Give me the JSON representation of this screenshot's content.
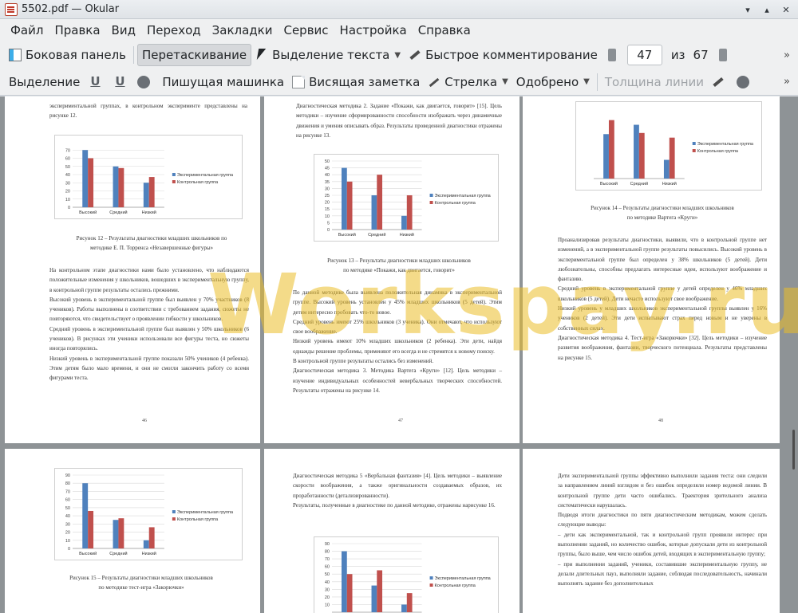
{
  "window": {
    "title": "5502.pdf — Okular",
    "buttons": [
      "▾",
      "▴",
      "✕"
    ]
  },
  "menu": [
    "Файл",
    "Правка",
    "Вид",
    "Переход",
    "Закладки",
    "Сервис",
    "Настройка",
    "Справка"
  ],
  "toolbar": {
    "sidebar": "Боковая панель",
    "browse": "Перетаскивание",
    "text_select": "Выделение текста",
    "quick_annot": "Быстрое комментирование",
    "page_current": "47",
    "page_of": "из",
    "page_total": "67",
    "more": "»"
  },
  "annot_toolbar": {
    "select": "Выделение",
    "typewriter": "Пишущая машинка",
    "pinned_note": "Висящая заметка",
    "arrow": "Стрелка",
    "approved": "Одобрено",
    "line_width": "Толщина линии",
    "more": "»"
  },
  "watermark": "Workspay.ru",
  "legend": {
    "exp": "Экспериментальная группа",
    "ctrl": "Контрольная группа"
  },
  "categories": [
    "Высокий",
    "Средний",
    "Низкий"
  ],
  "colors": {
    "exp": "#4f81bd",
    "ctrl": "#c0504d"
  },
  "pages": {
    "p46": {
      "top": "экспериментальной группах, в контрольном эксперименте представлены на рисунке 12.",
      "caption1": "Рисунок 12 – Результаты диагностики младших школьников по",
      "caption2": "методике Е. П. Торренса «Незавершенные фигуры»",
      "para1": "На контрольном этапе диагностики нами было установлено, что наблюдаются положительные изменения у школьников, вошедших в экспериментальную группу, в контрольной группе результаты остались прежними.",
      "para2": "Высокий уровень в экспериментальной группе был выявлен у 70% участников (8 учеников). Работы выполнены в соответствии с требованием задания, сюжеты не повторяются, что свидетельствует о проявлении гибкости у школьников.",
      "para3": "Средний уровень в экспериментальной группе был выявлен у 50% школьников (6 учеников). В рисунках эти ученики использовали все фигуры теста, но сюжеты иногда повторялись.",
      "para4": "Низкий уровень в экспериментальной группе показали 50% учеников (4 ребенка). Этим детям было мало времени, и они не смогли закончить работу со всеми фигурами теста.",
      "num": "46"
    },
    "p47": {
      "para1": "Диагностическая методика 2. Задание «Покажи, как двигается, говорит» [15]. Цель методики – изучение сформированности способности изображать через динамичные движения и умения описывать образ. Результаты проведенной диагностики отражены на рисунке 13.",
      "caption1": "Рисунок 13 – Результаты диагностики младших школьников",
      "caption2": "по методике «Покажи, как двигается, говорит»",
      "para2": "По данной методике была выявлена положительная динамика в экспериментальной группе. Высокий уровень установлен у 45% младших школьников (5 детей). Этим детям интересно пробовать что-то новое.",
      "para3": "Средний уровень имеют 25% школьников (3 ученика). Они отмечают, что используют свое воображение.",
      "para4": "Низкий уровень имеют 10% младших школьников (2 ребенка). Эти дети, найдя однажды решение проблемы, применяют его всегда и не стремятся к новому поиску.",
      "para5": "В контрольной группе результаты остались без изменений.",
      "para6": "Диагностическая методика 3. Методика Вартега «Круги» [12]. Цель методики – изучение индивидуальных особенностей невербальных творческих способностей. Результаты отражены на рисунке 14.",
      "num": "47"
    },
    "p48": {
      "caption1": "Рисунок 14 – Результаты диагностики младших школьников",
      "caption2": "по методике Вартега «Круги»",
      "para1": "Проанализировав результаты диагностики, выявили, что в контрольной группе нет изменений, а в экспериментальной группе результаты повысились. Высокий уровень в экспериментальной группе был определен у 38% школьников (5 детей). Дети любознательны, способны предлагать интересные идеи, используют воображение и фантазию.",
      "para2": "Средний уровень в экспериментальной группе у детей определен у 46% младших школьников (5 детей). Дети нечасто используют свое воображение.",
      "para3": "Низкий уровень у младших школьников экспериментальной группы выявлен у 16% учеников (2 детей). Эти дети испытывают страх перед новым и не уверены в собственных силах.",
      "para4": "Диагностическая методика 4. Тест-игра «Закорючки» [32]. Цель методики – изучение развития воображения, фантазии, творческого потенциала. Результаты представлены на рисунке 15.",
      "num": "48"
    },
    "p49": {
      "caption1": "Рисунок 15 – Результаты диагностики младших школьников",
      "caption2": "по методике тест-игра «Закорючки»"
    },
    "p50": {
      "para1": "Диагностическая методика 5 «Вербальная фантазия» [4]. Цель методики – выявление скорости воображения, а также оригинальности создаваемых образов, их проработанности (детализированности).",
      "para2": "Результаты, полученные в диагностике по данной методике, отражены нарисунке 16."
    },
    "p51": {
      "para1": "Дети экспериментальной группы эффективно выполнили задания теста: они следили за направлением линий взглядом и без ошибок определяли номер ведомой линии. В контрольной группе дети часто ошибались. Траектория зрительного анализа систематически нарушалась.",
      "para2": "Подводя итоги диагностики по пяти диагностическим методикам, можем сделать следующие выводы:",
      "para3": "– дети как экспериментальной, так и контрольной групп проявили интерес при выполнении заданий, но количество ошибок, которые допускали дети из контрольной группы, было выше, чем число ошибок детей, входящих в экспериментальную группу;",
      "para4": "– при выполнении заданий, ученики, составившие экспериментальную группу, не делали длительных пауз, выполняли задание, соблюдая последовательность, начинали выполнять задание без дополнительных"
    }
  },
  "chart_data": [
    {
      "type": "bar",
      "title": "",
      "categories": [
        "Высокий",
        "Средний",
        "Низкий"
      ],
      "ylim": [
        0,
        80
      ],
      "yticks": [
        0,
        10,
        20,
        30,
        40,
        50,
        60,
        70
      ],
      "series": [
        {
          "name": "Экспериментальная группа",
          "values": [
            70,
            50,
            30
          ]
        },
        {
          "name": "Контрольная группа",
          "values": [
            60,
            48,
            37
          ]
        }
      ]
    },
    {
      "type": "bar",
      "title": "",
      "categories": [
        "Высокий",
        "Средний",
        "Низкий"
      ],
      "ylim": [
        0,
        50
      ],
      "yticks": [
        0,
        5,
        10,
        15,
        20,
        25,
        30,
        35,
        40,
        45,
        50
      ],
      "series": [
        {
          "name": "Экспериментальная группа",
          "values": [
            45,
            25,
            10
          ]
        },
        {
          "name": "Контрольная группа",
          "values": [
            35,
            40,
            25
          ]
        }
      ]
    },
    {
      "type": "bar",
      "title": "",
      "categories": [
        "Высокий",
        "Средний",
        "Низкий"
      ],
      "ylim": [
        0,
        60
      ],
      "yticks": [],
      "series": [
        {
          "name": "Экспериментальная группа",
          "values": [
            38,
            46,
            16
          ]
        },
        {
          "name": "Контрольная группа",
          "values": [
            50,
            39,
            35
          ]
        }
      ]
    },
    {
      "type": "bar",
      "title": "",
      "categories": [
        "Высокий",
        "Средний",
        "Низкий"
      ],
      "ylim": [
        0,
        90
      ],
      "yticks": [
        0,
        10,
        20,
        30,
        40,
        50,
        60,
        70,
        80,
        90
      ],
      "series": [
        {
          "name": "Экспериментальная группа",
          "values": [
            80,
            35,
            10
          ]
        },
        {
          "name": "Контрольная группа",
          "values": [
            46,
            37,
            26
          ]
        }
      ]
    },
    {
      "type": "bar",
      "title": "",
      "categories": [
        "Высокий",
        "Средний",
        "Низкий"
      ],
      "ylim": [
        0,
        90
      ],
      "yticks": [
        10,
        20,
        30,
        40,
        50,
        60,
        70,
        80,
        90
      ],
      "series": [
        {
          "name": "Экспериментальная группа",
          "values": [
            80,
            35,
            10
          ]
        },
        {
          "name": "Контрольная группа",
          "values": [
            50,
            55,
            25
          ]
        }
      ]
    }
  ]
}
